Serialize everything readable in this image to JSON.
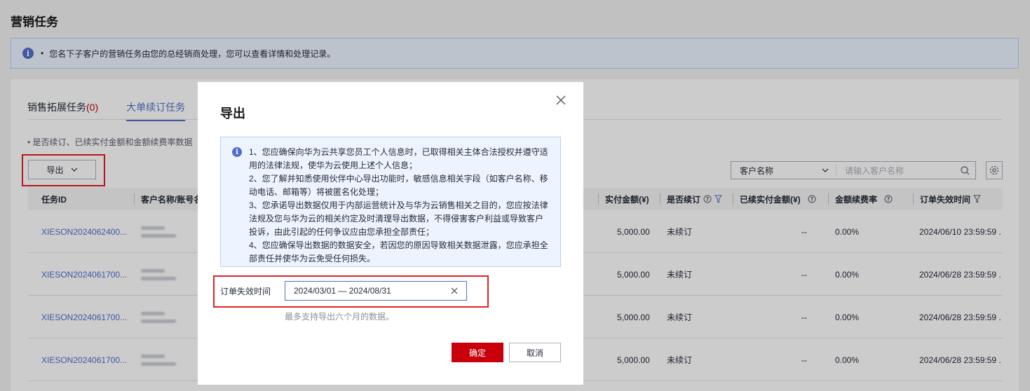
{
  "page": {
    "title": "营销任务",
    "notice": "您名下子客户的营销任务由您的总经销商处理，您可以查看详情和处理记录。"
  },
  "tabs": [
    {
      "label": "销售拓展任务",
      "count": "(0)"
    },
    {
      "label": "大单续订任务",
      "count": ""
    }
  ],
  "sub_note": "是否续订、已续实付金额和金额续费率数据",
  "toolbar": {
    "export_label": "导出",
    "search_select": "客户名称",
    "search_placeholder": "请输入客户名称"
  },
  "table": {
    "headers": [
      "任务ID",
      "客户名称/账号名",
      "实付金额(¥)",
      "是否续订",
      "已续实付金额(¥)",
      "金额续费率",
      "订单失效时间"
    ],
    "rows": [
      {
        "id": "XIESON2024062400...",
        "paid": "5,000.00",
        "renewed": "未续订",
        "renew_paid": "--",
        "rate": "0.00%",
        "expire": "2024/06/10 23:59:59 ."
      },
      {
        "id": "XIESON2024061700...",
        "paid": "5,000.00",
        "renewed": "未续订",
        "renew_paid": "--",
        "rate": "0.00%",
        "expire": "2024/06/28 23:59:59 ."
      },
      {
        "id": "XIESON2024061700...",
        "paid": "5,000.00",
        "renewed": "未续订",
        "renew_paid": "--",
        "rate": "0.00%",
        "expire": "2024/06/28 23:59:59 ."
      },
      {
        "id": "XIESON2024061700...",
        "paid": "5,000.00",
        "renewed": "未续订",
        "renew_paid": "--",
        "rate": "0.00%",
        "expire": "2024/06/28 23:59:59 ."
      }
    ]
  },
  "modal": {
    "title": "导出",
    "info_lines": [
      "1、您应确保向华为云共享您员工个人信息时，已取得相关主体合法授权并遵守适",
      "用的法律法规，使华为云使用上述个人信息；",
      "2、您了解并知悉使用伙伴中心导出功能时，敏感信息相关字段（如客户名称、移",
      "动电话、邮箱等）将被匿名化处理；",
      "3、您承诺导出数据仅用于内部运营统计及与华为云销售相关之目的，您应按法律",
      "法规及您与华为云的相关约定及时清理导出数据，不得侵害客户利益或导致客户",
      "投诉，由此引起的任何争议应由您承担全部责任；",
      "4、您应确保导出数据的数据安全，若因您的原因导致相关数据泄露，您应承担全",
      "部责任并使华为云免受任何损失。"
    ],
    "field_label": "订单失效时间",
    "date_value": "2024/03/01 — 2024/08/31",
    "hint": "最多支持导出六个月的数据。",
    "ok_label": "确定",
    "cancel_label": "取消"
  }
}
